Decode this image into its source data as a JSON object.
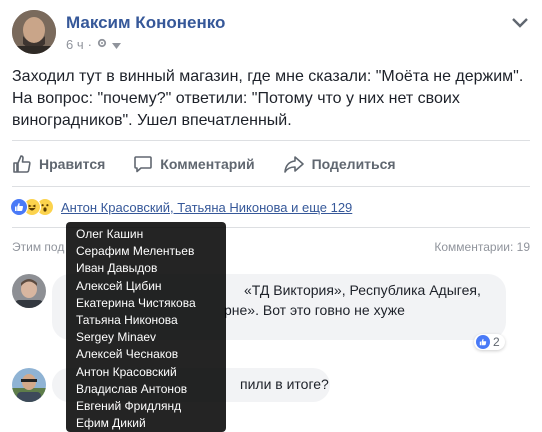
{
  "post": {
    "author": "Максим Кононенко",
    "time": "6 ч",
    "audience_icon": "gear-icon",
    "text_lines": [
      "Заходил тут в винный магазин, где мне сказали: \"Моёта не держим\".",
      "На вопрос: \"почему?\" ответили: \"Потому что у них нет своих",
      "виноградников\". Ушел впечатленный."
    ]
  },
  "actions": {
    "like": "Нравится",
    "comment": "Комментарий",
    "share": "Поделиться"
  },
  "reactions": {
    "summary": "Антон Красовский, Татьяна Никонова и еще 129",
    "icons": [
      "like-icon",
      "haha-icon",
      "wow-icon"
    ]
  },
  "comments_bar": {
    "left": "Этим под",
    "right": "Комментарии: 19"
  },
  "comments": [
    {
      "line1": "«ТД Виктория», Республика Адыгея,",
      "line2": "рне». Вот это говно не хуже",
      "likes": "2"
    },
    {
      "text": "пили в итоге?"
    }
  ],
  "tooltip": {
    "names": [
      "Олег Кашин",
      "Серафим Мелентьев",
      "Иван Давыдов",
      "Алексей Цибин",
      "Екатерина Чистякова",
      "Татьяна Никонова",
      "Sergey Minaev",
      "Алексей Чеснаков",
      "Антон Красовский",
      "Владислав Антонов",
      "Евгений Фридлянд",
      "Ефим Дикий"
    ]
  },
  "colors": {
    "link": "#365899",
    "text": "#1d2129",
    "muted": "#90949c",
    "action": "#606770",
    "like_blue": "#4a7af7",
    "tooltip_bg": "#000000"
  }
}
